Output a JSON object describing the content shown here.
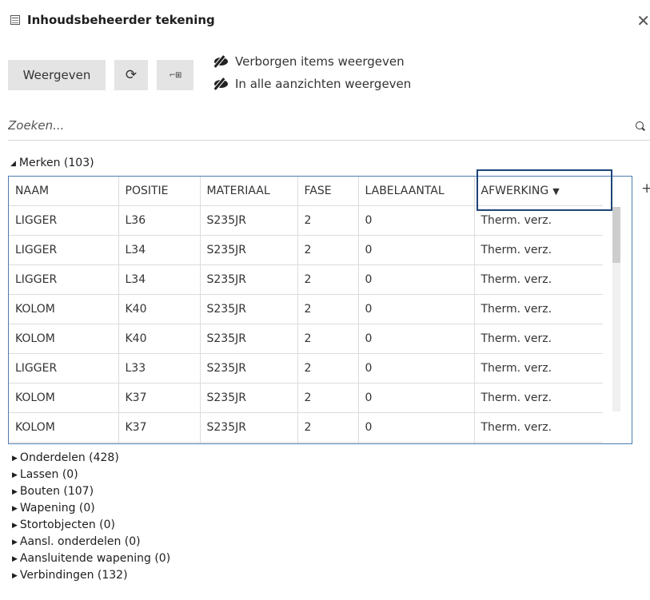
{
  "window": {
    "title": "Inhoudsbeheerder tekening",
    "title_icon": "table-panel-icon",
    "close_glyph": "✕"
  },
  "toolbar": {
    "show_label": "Weergeven",
    "refresh_glyph": "⟳",
    "pick_glyph": "⌐⊞",
    "options": [
      {
        "label": "Verborgen items weergeven",
        "icon": "eye-slash-icon"
      },
      {
        "label": "In alle aanzichten weergeven",
        "icon": "eye-slash-icon"
      }
    ]
  },
  "search": {
    "placeholder": "Zoeken...",
    "value": ""
  },
  "marks_group": {
    "expand_glyph": "◢",
    "label": "Merken (103)",
    "columns": [
      "NAAM",
      "POSITIE",
      "MATERIAAL",
      "FASE",
      "LABELAANTAL",
      "AFWERKING"
    ],
    "sort_glyph": "▼",
    "rows": [
      [
        "LIGGER",
        "L36",
        "S235JR",
        "2",
        "0",
        "Therm. verz."
      ],
      [
        "LIGGER",
        "L34",
        "S235JR",
        "2",
        "0",
        "Therm. verz."
      ],
      [
        "LIGGER",
        "L34",
        "S235JR",
        "2",
        "0",
        "Therm. verz."
      ],
      [
        "KOLOM",
        "K40",
        "S235JR",
        "2",
        "0",
        "Therm. verz."
      ],
      [
        "KOLOM",
        "K40",
        "S235JR",
        "2",
        "0",
        "Therm. verz."
      ],
      [
        "LIGGER",
        "L33",
        "S235JR",
        "2",
        "0",
        "Therm. verz."
      ],
      [
        "KOLOM",
        "K37",
        "S235JR",
        "2",
        "0",
        "Therm. verz."
      ],
      [
        "KOLOM",
        "K37",
        "S235JR",
        "2",
        "0",
        "Therm. verz."
      ]
    ],
    "add_column_glyph": "+"
  },
  "collapsed_groups": {
    "expand_glyph": "▶",
    "items": [
      "Onderdelen (428)",
      "Lassen (0)",
      "Bouten (107)",
      "Wapening (0)",
      "Stortobjecten (0)",
      "Aansl. onderdelen (0)",
      "Aansluitende wapening (0)",
      "Verbindingen (132)"
    ]
  },
  "colors": {
    "accent_border": "#1d4577",
    "grid_border": "#4d7bb0",
    "button_bg": "#e4e4e4"
  }
}
